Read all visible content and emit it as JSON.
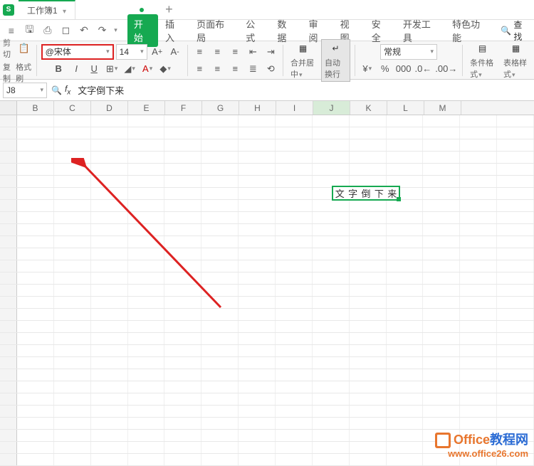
{
  "title_bar": {
    "app_letter": "S",
    "workbook_name": "工作簿1",
    "plus": "+"
  },
  "qat": {
    "icons": [
      "menu",
      "save",
      "print",
      "preview",
      "undo",
      "redo"
    ]
  },
  "menu": {
    "start": "开始",
    "insert": "插入",
    "page_layout": "页面布局",
    "formula": "公式",
    "data": "数据",
    "review": "审阅",
    "view": "视图",
    "security": "安全",
    "developer": "开发工具",
    "special": "特色功能",
    "search": "查找"
  },
  "ribbon": {
    "cut": "剪切",
    "copy": "复制",
    "format_painter": "格式刷",
    "font_name": "@宋体",
    "font_size": "14",
    "merge": "合并居中",
    "wrap": "自动换行",
    "number_format": "常规",
    "cond_format": "条件格式",
    "table_style": "表格样式"
  },
  "formula_bar": {
    "cell_ref": "J8",
    "formula_text": "文字倒下来"
  },
  "columns": [
    "B",
    "C",
    "D",
    "E",
    "F",
    "G",
    "H",
    "I",
    "J",
    "K",
    "L",
    "M"
  ],
  "selected_cell": {
    "text": "文字倒下来",
    "chars": [
      "文",
      "字",
      "倒",
      "下",
      "来"
    ]
  },
  "watermark": {
    "line1_a": "Office",
    "line1_b": "教程网",
    "line2": "www.office26.com"
  }
}
